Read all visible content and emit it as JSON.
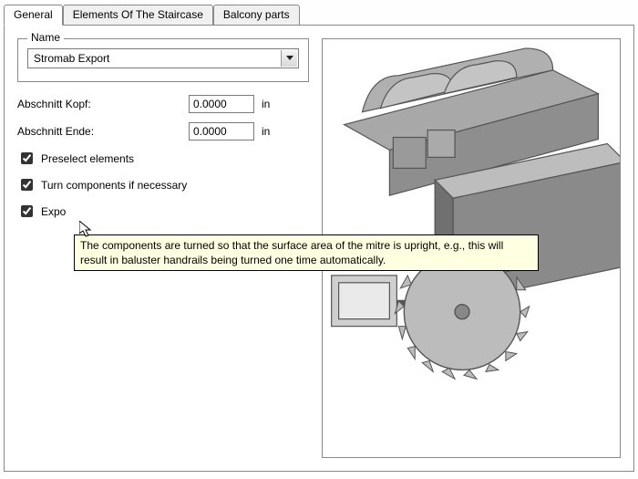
{
  "tabs": {
    "general": "General",
    "elements": "Elements Of The Staircase",
    "balcony": "Balcony parts"
  },
  "name_group": {
    "title": "Name",
    "selected": "Stromab Export"
  },
  "fields": {
    "kopf_label": "Abschnitt Kopf:",
    "kopf_value": "0.0000",
    "ende_label": "Abschnitt Ende:",
    "ende_value": "0.0000",
    "unit": "in"
  },
  "checks": {
    "preselect": "Preselect elements",
    "turn": "Turn components if necessary",
    "export": "Expo"
  },
  "tooltip": "The components are turned so that the surface area of the mitre is upright, e.g., this will result in baluster handrails being turned one time automatically."
}
